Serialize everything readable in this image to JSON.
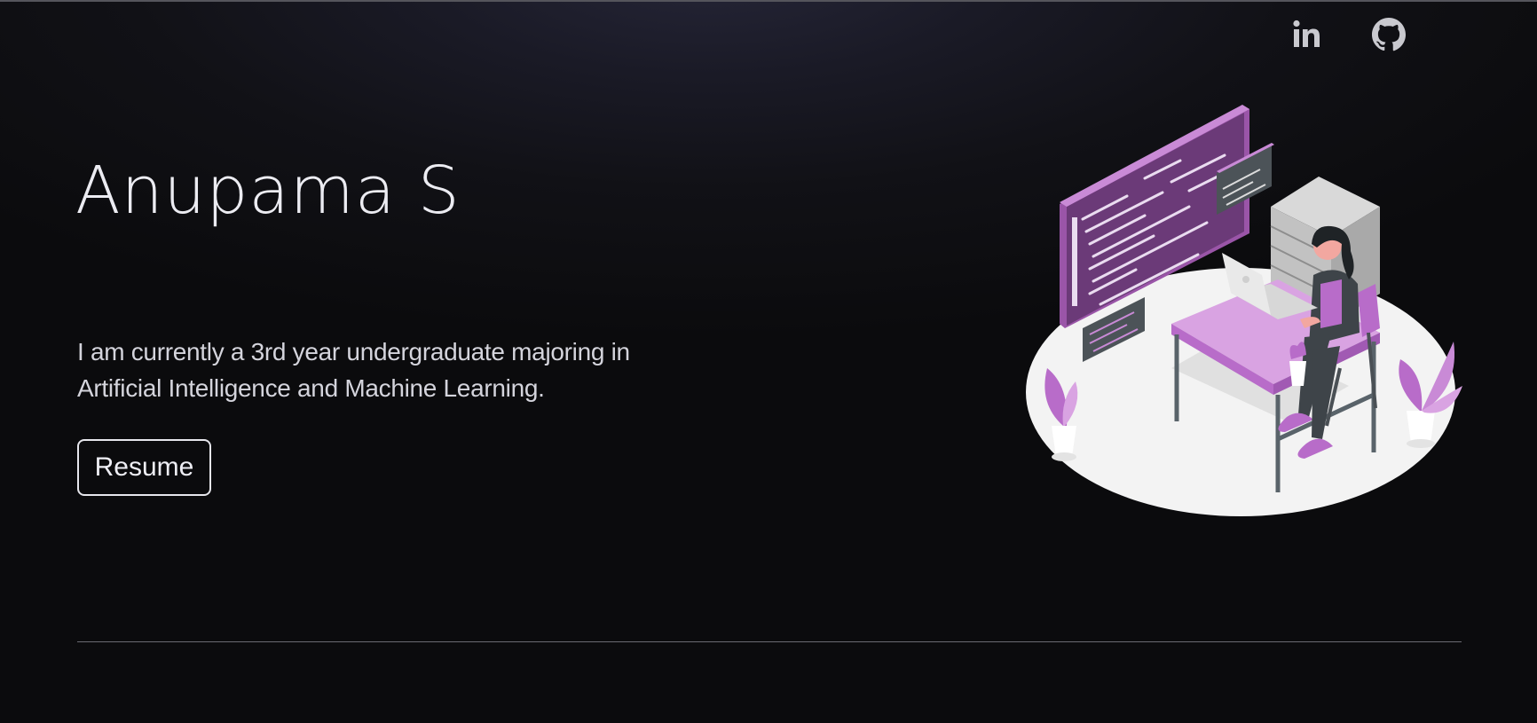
{
  "header": {
    "social": [
      {
        "name": "LinkedIn",
        "icon": "linkedin-icon"
      },
      {
        "name": "GitHub",
        "icon": "github-icon"
      }
    ]
  },
  "hero": {
    "name": "Anupama S",
    "bio": "I am currently a 3rd year undergraduate majoring in Artificial Intelligence and Machine Learning.",
    "resume_label": "Resume",
    "illustration": "developer-at-desk-illustration"
  },
  "colors": {
    "background": "#0b0b0d",
    "accent_purple": "#b86cc9",
    "text": "#e8e8ee"
  }
}
